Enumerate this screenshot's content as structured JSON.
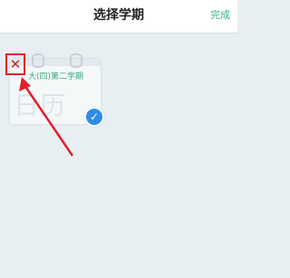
{
  "header": {
    "title": "选择学期",
    "done_label": "完成"
  },
  "semester_card": {
    "label": "大(四)第二学期",
    "watermark": "日历",
    "selected": true,
    "close_icon": "close-icon",
    "check_icon": "checkmark-icon"
  },
  "colors": {
    "accent_green": "#39b08f",
    "highlight_red": "#e0202a",
    "check_blue": "#2f8ce4",
    "background": "#e8eff3"
  }
}
